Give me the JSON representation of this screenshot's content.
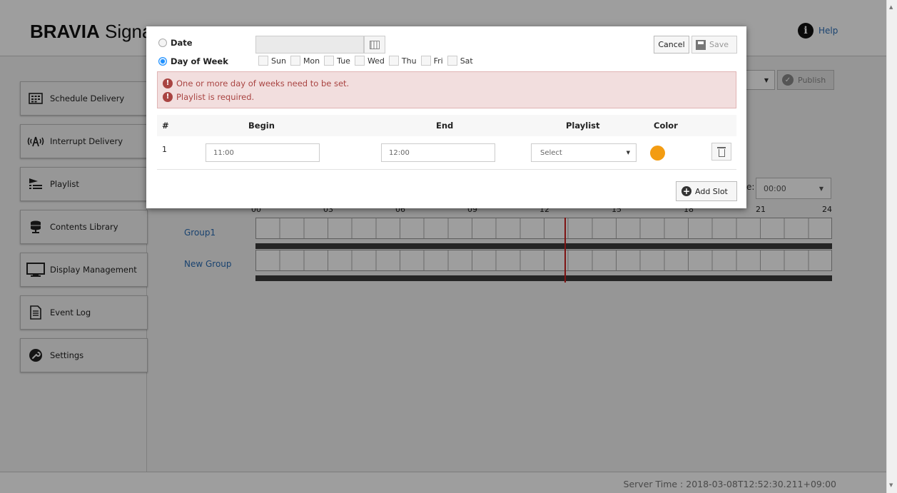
{
  "header": {
    "brand_bold": "BRAVIA",
    "brand_rest": " Signage",
    "help_label": "Help"
  },
  "sidebar": {
    "items": [
      {
        "label": "Schedule Delivery",
        "icon": "calendar-icon"
      },
      {
        "label": "Interrupt Delivery",
        "icon": "broadcast-icon"
      },
      {
        "label": "Playlist",
        "icon": "playlist-icon"
      },
      {
        "label": "Contents Library",
        "icon": "database-icon"
      },
      {
        "label": "Display Management",
        "icon": "monitor-icon"
      },
      {
        "label": "Event Log",
        "icon": "document-icon"
      },
      {
        "label": "Settings",
        "icon": "wrench-icon"
      }
    ]
  },
  "toolbar": {
    "publish_label": "Publish"
  },
  "schedule": {
    "time_label": "e:",
    "time_value": "00:00",
    "hour_ticks": [
      "00",
      "03",
      "06",
      "09",
      "12",
      "15",
      "18",
      "21",
      "24"
    ],
    "groups": [
      "Group1",
      "New Group"
    ],
    "current_time_hour": 12.87
  },
  "footer": {
    "server_time": "Server Time : 2018-03-08T12:52:30.211+09:00"
  },
  "modal": {
    "date_label": "Date",
    "dow_label": "Day of Week",
    "selected_mode": "Day of Week",
    "date_value": "",
    "days": [
      {
        "label": "Sun",
        "checked": false
      },
      {
        "label": "Mon",
        "checked": false
      },
      {
        "label": "Tue",
        "checked": false
      },
      {
        "label": "Wed",
        "checked": false
      },
      {
        "label": "Thu",
        "checked": false
      },
      {
        "label": "Fri",
        "checked": false
      },
      {
        "label": "Sat",
        "checked": false
      }
    ],
    "cancel_label": "Cancel",
    "save_label": "Save",
    "errors": [
      "One or more day of weeks need to be set.",
      "Playlist is required."
    ],
    "columns": {
      "num": "#",
      "begin": "Begin",
      "end": "End",
      "playlist": "Playlist",
      "color": "Color"
    },
    "slots": [
      {
        "num": "1",
        "begin": "11:00",
        "end": "12:00",
        "playlist": "Select",
        "color": "#f39c12"
      }
    ],
    "add_slot_label": "Add Slot"
  }
}
